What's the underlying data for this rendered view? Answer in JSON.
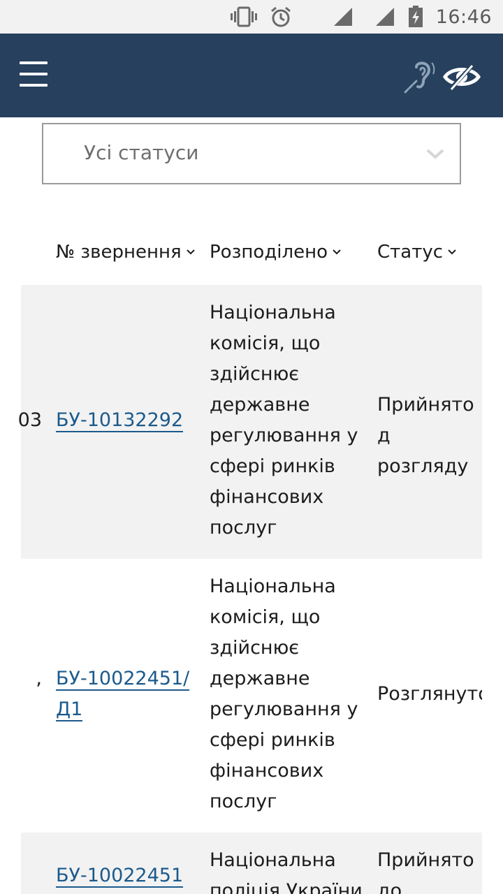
{
  "status_bar": {
    "time": "16:46",
    "icons": [
      "vibrate-icon",
      "alarm-icon",
      "signal-icon",
      "signal-icon",
      "battery-charging-icon"
    ]
  },
  "header": {
    "menu_icon": "hamburger-menu-icon",
    "accessibility_icons": [
      "hearing-accessibility-icon",
      "vision-accessibility-icon"
    ],
    "background": "#26405e"
  },
  "filter": {
    "selected": "Усі статуси"
  },
  "table": {
    "columns": [
      {
        "label": "№ звернення"
      },
      {
        "label": "Розподілено"
      },
      {
        "label": "Статус"
      }
    ],
    "rows": [
      {
        "left_fragment": "03",
        "number": "БУ-10132292",
        "distributed": "Національна комісія, що здійснює державне регулювання у сфері ринків фінансових послуг",
        "status": "Прийнято до розгляду",
        "status_visible": "Прийнято д\nрозгляду"
      },
      {
        "left_fragment": ",",
        "number": "БУ-10022451/Д1",
        "distributed": "Національна комісія, що здійснює державне регулювання у сфері ринків фінансових послуг",
        "status": "Розглянуто"
      },
      {
        "left_fragment": "",
        "number": "БУ-10022451",
        "distributed": "Національна поліція України",
        "status": "Прийнято до розгляду"
      }
    ]
  },
  "colors": {
    "link": "#1b5a8c",
    "row_shade": "#f2f2f2",
    "header": "#26405e"
  }
}
